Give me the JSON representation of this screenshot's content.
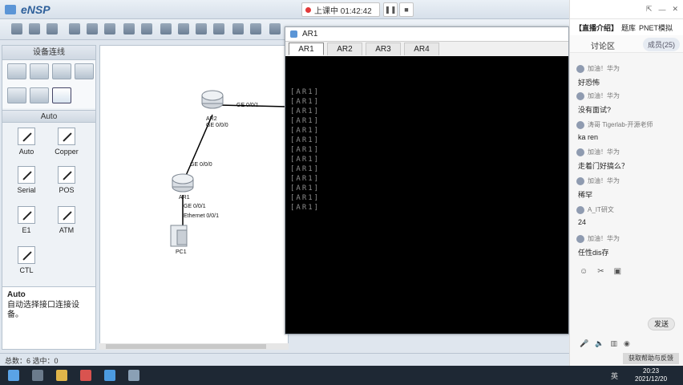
{
  "app": {
    "title": "eNSP"
  },
  "recording": {
    "label": "上课中 01:42:42"
  },
  "left_panel": {
    "header": "设备连线",
    "sub_header": "Auto",
    "cables": [
      {
        "label": "Auto",
        "icon": "auto-cable-icon"
      },
      {
        "label": "Copper",
        "icon": "copper-cable-icon"
      },
      {
        "label": "Serial",
        "icon": "serial-cable-icon"
      },
      {
        "label": "POS",
        "icon": "pos-cable-icon"
      },
      {
        "label": "E1",
        "icon": "e1-cable-icon"
      },
      {
        "label": "ATM",
        "icon": "atm-cable-icon"
      },
      {
        "label": "CTL",
        "icon": "ctl-cable-icon"
      }
    ],
    "desc_title": "Auto",
    "desc_text": "自动选择接口连接设备。"
  },
  "topology": {
    "devices": [
      "AR2",
      "AR1",
      "PC1"
    ],
    "links": [
      {
        "a_if": "GE 0/0/1",
        "b_if": ""
      },
      {
        "a_if": "GE 0/0/0",
        "b_if": "GE 0/0/0"
      },
      {
        "a_if": "GE 0/0/1",
        "b_if": "Ethernet 0/0/1"
      }
    ]
  },
  "status": {
    "text": "总数：6 选中：0"
  },
  "terminal": {
    "title": "AR1",
    "tabs": [
      "AR1",
      "AR2",
      "AR3",
      "AR4"
    ],
    "active_tab": "AR1",
    "lines": [
      "[AR1]",
      "[AR1]",
      "[AR1]",
      "[AR1]",
      "[AR1]",
      "[AR1]",
      "[AR1]",
      "[AR1]",
      "[AR1]",
      "[AR1]",
      "[AR1]",
      "[AR1]",
      "[AR1]"
    ]
  },
  "chat": {
    "tabs": [
      "【直播介绍】",
      "题库",
      "PNET模拟"
    ],
    "header": "讨论区",
    "members": "成员(25)",
    "messages": [
      {
        "user": "加油！华为",
        "text": "好恐怖"
      },
      {
        "user": "加油！华为",
        "text": "没有面试?"
      },
      {
        "user": "涛哥 Tigerlab-开源老师",
        "text": "ka ren"
      },
      {
        "user": "加油！华为",
        "text": "走着门好搞么？"
      },
      {
        "user": "加油！华为",
        "text": "稀罕"
      },
      {
        "user": "A_IT研文",
        "text": "24"
      },
      {
        "user": "加油！华为",
        "text": "任性dis存"
      }
    ],
    "send": "发送",
    "ask": "获取帮助与反馈"
  },
  "taskbar": {
    "time": "20:23",
    "date": "2021/12/20",
    "ime": "英"
  }
}
